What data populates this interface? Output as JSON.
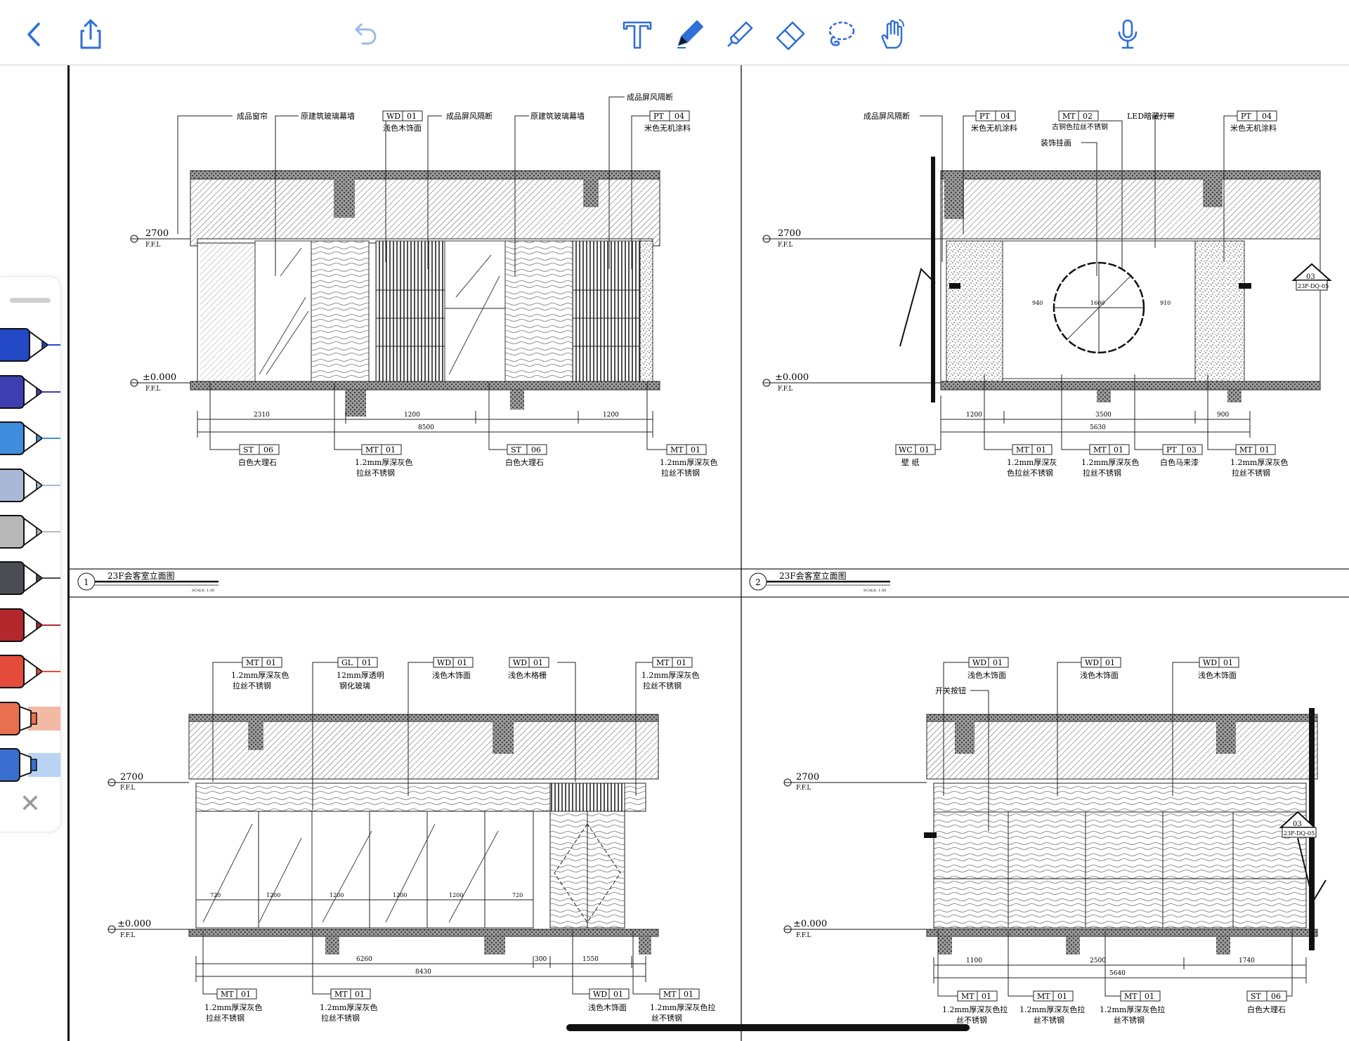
{
  "colors": {
    "ios_blue": "#2f6fd6",
    "ios_blue_light": "#9cb9e6",
    "palette": [
      "#2349c7",
      "#3d3fb1",
      "#3f8ede",
      "#a9b8d6",
      "#b8b8b8",
      "#4a4e52",
      "#b3282d",
      "#e44b3a",
      "#e8704f",
      "#3a6fd0"
    ]
  },
  "toolbar": {
    "icons": [
      "back-chevron-icon",
      "share-icon",
      "undo-icon",
      "text-tool-icon",
      "pen-tool-icon",
      "highlighter-tool-icon",
      "eraser-tool-icon",
      "lasso-tool-icon",
      "touch-hand-icon",
      "microphone-icon"
    ]
  },
  "drawing_sheet": {
    "views": [
      {
        "number": "1",
        "title": "23F会客室立面图",
        "scale": "SCALE: 1:50",
        "elevation_top": "2700",
        "elevation_bottom": "±0.000",
        "level_label": "F.F.L",
        "top_notes": [
          "成品窗帘",
          "原建筑玻璃幕墙",
          "浅色木饰面",
          "成品屏风隔断",
          "原建筑玻璃幕墙",
          "成品屏风隔断",
          "米色无机涂料"
        ],
        "top_tags": [
          {
            "code": "WD",
            "num": "01"
          },
          {
            "code": "PT",
            "num": "04"
          }
        ],
        "bottom_tags": [
          {
            "code": "ST",
            "num": "06",
            "text": "白色大理石",
            "text2": ""
          },
          {
            "code": "MT",
            "num": "01",
            "text": "1.2mm厚深灰色",
            "text2": "拉丝不锈钢"
          },
          {
            "code": "ST",
            "num": "06",
            "text": "白色大理石",
            "text2": ""
          },
          {
            "code": "MT",
            "num": "01",
            "text": "1.2mm厚深灰色",
            "text2": "拉丝不锈钢"
          }
        ],
        "dims": [
          "2310",
          "1200",
          "1200",
          "8500"
        ]
      },
      {
        "number": "2",
        "title": "23F会客室立面图",
        "scale": "SCALE: 1:50",
        "elevation_top": "2700",
        "elevation_bottom": "±0.000",
        "level_label": "F.F.L",
        "top_notes": [
          "成品屏风隔断",
          "米色无机涂料",
          "古铜色拉丝不锈钢",
          "LED暗藏灯带",
          "装饰挂画",
          "米色无机涂料"
        ],
        "top_tags": [
          {
            "code": "PT",
            "num": "04"
          },
          {
            "code": "MT",
            "num": "02"
          },
          {
            "code": "PT",
            "num": "04"
          }
        ],
        "bottom_tags": [
          {
            "code": "WC",
            "num": "01",
            "text": "壁  纸",
            "text2": ""
          },
          {
            "code": "MT",
            "num": "01",
            "text": "1.2mm厚深灰",
            "text2": "色拉丝不锈钢"
          },
          {
            "code": "MT",
            "num": "01",
            "text": "1.2mm厚深灰色",
            "text2": "拉丝不锈钢"
          },
          {
            "code": "PT",
            "num": "03",
            "text": "白色马来漆",
            "text2": ""
          },
          {
            "code": "MT",
            "num": "01",
            "text": "1.2mm厚深灰色",
            "text2": "拉丝不锈钢"
          }
        ],
        "dims": [
          "1200",
          "3500",
          "900",
          "5630",
          "940",
          "1600",
          "910"
        ],
        "detail_ref": {
          "num": "03",
          "sheet": "23F-DQ-05"
        }
      },
      {
        "number": "",
        "title": "",
        "scale": "",
        "elevation_top": "2700",
        "elevation_bottom": "±0.000",
        "level_label": "F.F.L",
        "top_tags": [
          {
            "code": "MT",
            "num": "01",
            "text": "1.2mm厚深灰色",
            "text2": "拉丝不锈钢"
          },
          {
            "code": "GL",
            "num": "01",
            "text": "12mm厚透明",
            "text2": "钢化玻璃"
          },
          {
            "code": "WD",
            "num": "01",
            "text": "浅色木饰面",
            "text2": ""
          },
          {
            "code": "WD",
            "num": "01",
            "text": "浅色木格栅",
            "text2": ""
          },
          {
            "code": "MT",
            "num": "01",
            "text": "1.2mm厚深灰色",
            "text2": "拉丝不锈钢"
          }
        ],
        "bottom_tags": [
          {
            "code": "MT",
            "num": "01",
            "text": "1.2mm厚深灰色",
            "text2": "拉丝不锈钢"
          },
          {
            "code": "MT",
            "num": "01",
            "text": "1.2mm厚深灰色",
            "text2": "拉丝不锈钢"
          },
          {
            "code": "WD",
            "num": "01",
            "text": "浅色木饰面",
            "text2": ""
          },
          {
            "code": "MT",
            "num": "01",
            "text": "1.2mm厚深灰色拉",
            "text2": "丝不锈钢"
          }
        ],
        "dims": [
          "6260",
          "300",
          "1550",
          "8430",
          "720",
          "1200",
          "1200",
          "1200",
          "1200",
          "720"
        ]
      },
      {
        "number": "",
        "title": "",
        "scale": "",
        "elevation_top": "2700",
        "elevation_bottom": "±0.000",
        "level_label": "F.F.L",
        "top_tags": [
          {
            "code": "WD",
            "num": "01",
            "text": "浅色木饰面",
            "text2": ""
          },
          {
            "code": "WD",
            "num": "01",
            "text": "浅色木饰面",
            "text2": ""
          },
          {
            "code": "WD",
            "num": "01",
            "text": "浅色木饰面",
            "text2": ""
          }
        ],
        "top_notes": [
          "开关按钮"
        ],
        "bottom_tags": [
          {
            "code": "MT",
            "num": "01",
            "text": "1.2mm厚深灰色拉",
            "text2": "丝不锈钢"
          },
          {
            "code": "MT",
            "num": "01",
            "text": "1.2mm厚深灰色拉",
            "text2": "丝不锈钢"
          },
          {
            "code": "MT",
            "num": "01",
            "text": "1.2mm厚深灰色拉",
            "text2": "丝不锈钢"
          },
          {
            "code": "ST",
            "num": "06",
            "text": "白色大理石",
            "text2": ""
          }
        ],
        "dims": [
          "1100",
          "2500",
          "1740",
          "5640"
        ],
        "detail_ref": {
          "num": "03",
          "sheet": "23F-DQ-05"
        }
      }
    ]
  }
}
